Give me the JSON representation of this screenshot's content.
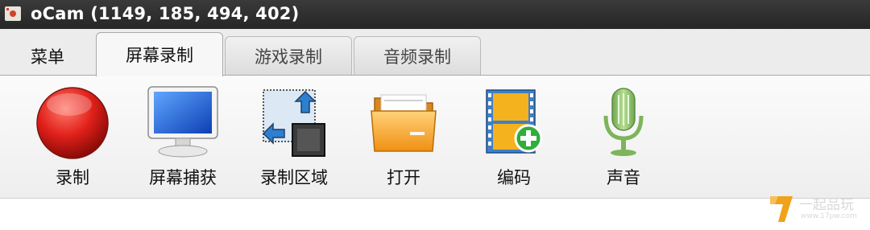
{
  "window": {
    "title": "oCam (1149, 185, 494, 402)",
    "icon": "ocam-app-icon"
  },
  "tabs": [
    {
      "label": "菜单",
      "selected": false
    },
    {
      "label": "屏幕录制",
      "selected": true
    },
    {
      "label": "游戏录制",
      "selected": false
    },
    {
      "label": "音频录制",
      "selected": false
    }
  ],
  "toolbar": {
    "record": {
      "label": "录制",
      "icon": "record-icon"
    },
    "capture": {
      "label": "屏幕捕获",
      "icon": "monitor-icon"
    },
    "region": {
      "label": "录制区域",
      "icon": "resize-region-icon"
    },
    "open": {
      "label": "打开",
      "icon": "folder-icon"
    },
    "codec": {
      "label": "编码",
      "icon": "film-add-icon"
    },
    "sound": {
      "label": "声音",
      "icon": "microphone-icon"
    }
  },
  "watermark": {
    "name": "一起品玩",
    "url": "www.17pw.com"
  },
  "colors": {
    "titlebar": "#2e2e2e",
    "record": "#e0201a",
    "accent_orange": "#f39a1e",
    "mic_green": "#8ec06c"
  }
}
